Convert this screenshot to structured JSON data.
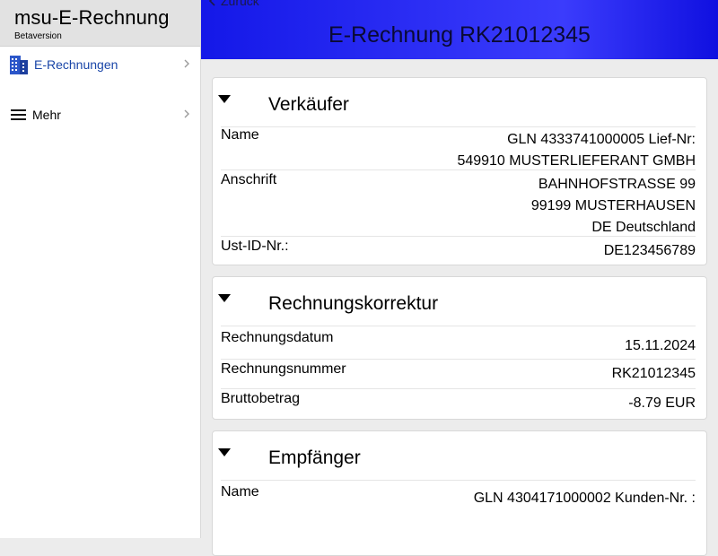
{
  "app": {
    "title": "msu-E-Rechnung",
    "subtitle": "Betaversion"
  },
  "sidebar": {
    "items": [
      {
        "label": "E-Rechnungen",
        "icon": "building-icon"
      },
      {
        "label": "Mehr",
        "icon": "menu-icon"
      }
    ]
  },
  "header": {
    "back_label": "Zurück",
    "title": "E-Rechnung RK21012345"
  },
  "sections": {
    "seller": {
      "title": "Verkäufer",
      "name_label": "Name",
      "name_line1": "GLN 4333741000005 Lief-Nr:",
      "name_line2": "549910 MUSTERLIEFERANT GMBH",
      "address_label": "Anschrift",
      "address_line1": "BAHNHOFSTRASSE 99",
      "address_line2": "99199 MUSTERHAUSEN",
      "address_line3": "DE Deutschland",
      "vat_label": "Ust-ID-Nr.:",
      "vat_value": "DE123456789"
    },
    "correction": {
      "title": "Rechnungskorrektur",
      "date_label": "Rechnungsdatum",
      "date_value": "15.11.2024",
      "number_label": "Rechnungsnummer",
      "number_value": "RK21012345",
      "gross_label": "Bruttobetrag",
      "gross_value": "-8.79 EUR"
    },
    "recipient": {
      "title": "Empfänger",
      "name_label": "Name",
      "name_line1": "GLN 4304171000002 Kunden-Nr. :"
    }
  },
  "colors": {
    "header_blue": "#2b2cf5",
    "nav_active": "#1a46a8"
  }
}
